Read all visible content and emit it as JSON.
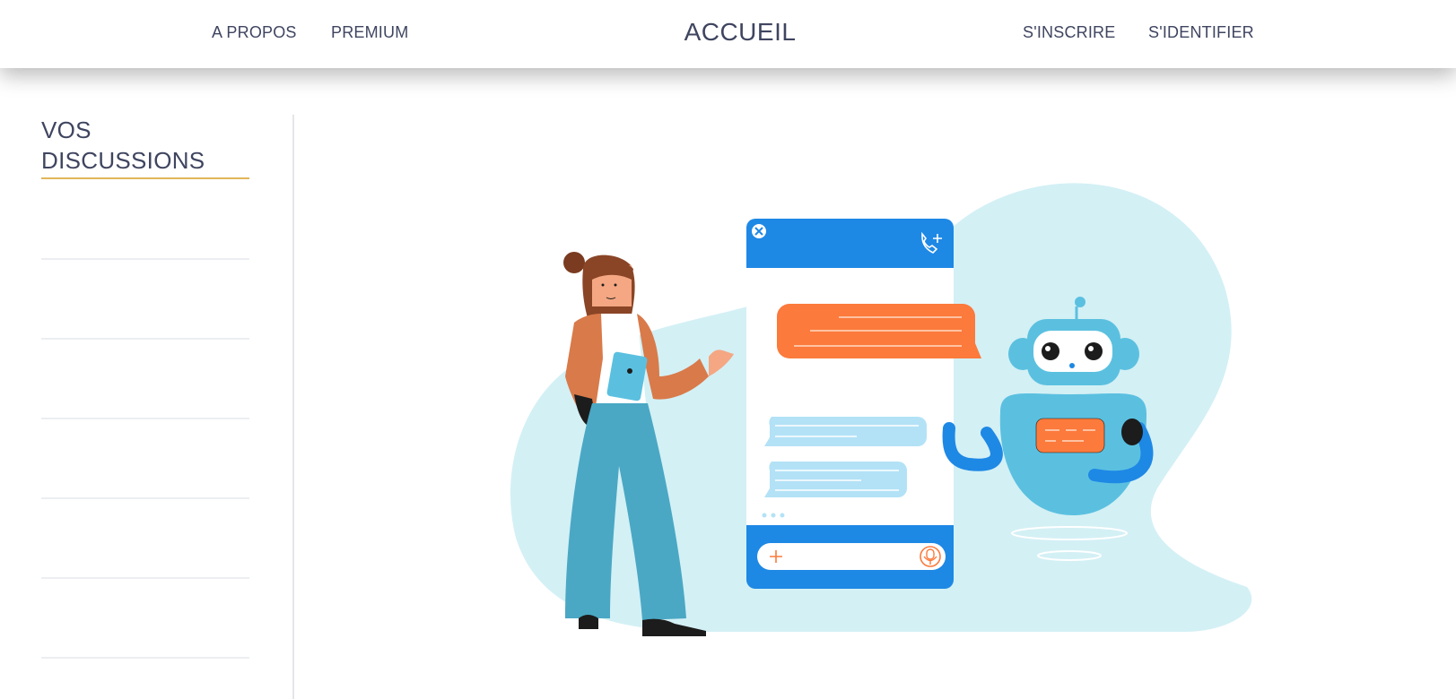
{
  "navbar": {
    "about": "A PROPOS",
    "premium": "PREMIUM",
    "home": "ACCUEIL",
    "signup": "S'INSCRIRE",
    "login": "S'IDENTIFIER"
  },
  "sidebar": {
    "title_line1": "VOS",
    "title_line2": "DISCUSSIONS",
    "items": [
      {
        "label": ""
      },
      {
        "label": ""
      },
      {
        "label": ""
      },
      {
        "label": ""
      },
      {
        "label": ""
      },
      {
        "label": ""
      }
    ]
  },
  "illustration": {
    "subject": "woman-with-tablet-chatting-with-robot",
    "colors": {
      "blob": "#d3f0f5",
      "phone": "#1e88e5",
      "bubble_out": "#fb7a3c",
      "bubble_in": "#b3e2f6",
      "robot": "#5bc0e0",
      "pants": "#4aa8c4",
      "jacket": "#d97a4a"
    }
  },
  "theme": {
    "accent": "#e2b65a",
    "text": "#3f4560",
    "divider": "#eceef1"
  }
}
